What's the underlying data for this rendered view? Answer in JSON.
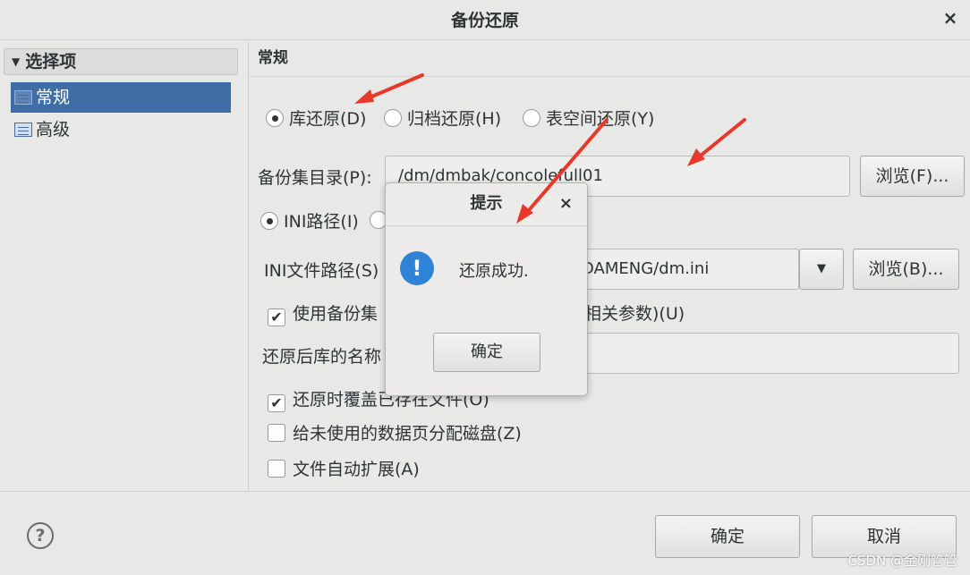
{
  "window": {
    "title": "备份还原"
  },
  "sidebar": {
    "group_label": "选择项",
    "items": [
      {
        "label": "常规",
        "selected": true
      },
      {
        "label": "高级",
        "selected": false
      }
    ]
  },
  "main": {
    "section_title": "常规",
    "restore_types": [
      {
        "label": "库还原(D)",
        "selected": true
      },
      {
        "label": "归档还原(H)",
        "selected": false
      },
      {
        "label": "表空间还原(Y)",
        "selected": false
      }
    ],
    "backup_dir": {
      "label": "备份集目录(P):",
      "value": "/dm/dmbak/concolefull01",
      "browse_label": "浏览(F)..."
    },
    "ini_radio": {
      "label": "INI路径(I)",
      "selected": true
    },
    "ini_path": {
      "label": "INI文件路径(S)",
      "value": "DAMENG/dm.ini",
      "browse_label": "浏览(B)..."
    },
    "use_backup_params": {
      "label_left": "使用备份集",
      "label_right": "相关参数)(U)",
      "checked": true
    },
    "restore_db_name": {
      "label": "还原后库的名称",
      "value": ""
    },
    "overwrite_files": {
      "label": "还原时覆盖已存在文件(O)",
      "checked": true
    },
    "alloc_disk": {
      "label": "给未使用的数据页分配磁盘(Z)",
      "checked": false
    },
    "auto_extend": {
      "label": "文件自动扩展(A)",
      "checked": false
    }
  },
  "footer": {
    "help_label": "?",
    "ok_label": "确定",
    "cancel_label": "取消",
    "watermark": "CSDN @金刚管管"
  },
  "dialog": {
    "title": "提示",
    "close_glyph": "×",
    "icon_glyph": "!",
    "message": "还原成功.",
    "ok_label": "确定"
  },
  "glyphs": {
    "close": "×",
    "triangle": "▼",
    "check": "✔",
    "dropdown": "▼"
  },
  "colors": {
    "selection": "#3f6ea6",
    "info_icon": "#2f83d6",
    "arrow": "#e8382c"
  }
}
